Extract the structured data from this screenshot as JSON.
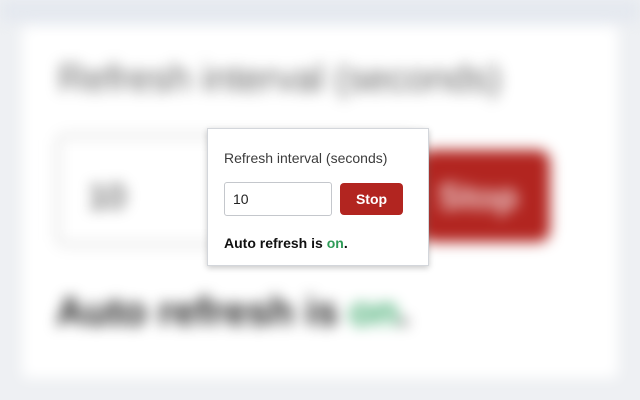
{
  "refresh": {
    "label": "Refresh interval (seconds)",
    "interval_value": "10",
    "button_label": "Stop"
  },
  "status": {
    "prefix": "Auto refresh is ",
    "state": "on",
    "suffix": "."
  },
  "colors": {
    "button": "#b22520",
    "status_on": "#2e9b57"
  }
}
